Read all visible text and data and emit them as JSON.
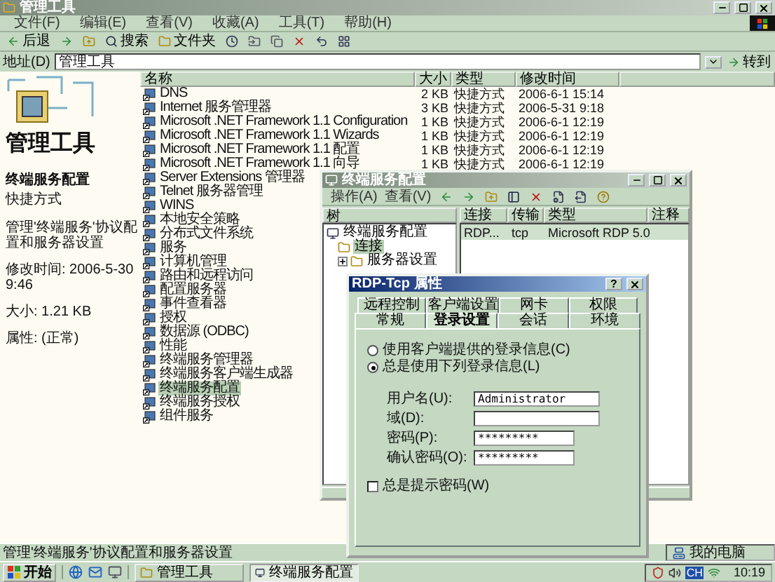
{
  "window": {
    "title": "管理工具"
  },
  "menu": [
    "文件(F)",
    "编辑(E)",
    "查看(V)",
    "收藏(A)",
    "工具(T)",
    "帮助(H)"
  ],
  "toolbar": [
    {
      "kind": "back",
      "label": "后退"
    },
    {
      "kind": "forward"
    },
    {
      "kind": "up"
    },
    {
      "kind": "search",
      "label": "搜索"
    },
    {
      "kind": "folders",
      "label": "文件夹"
    },
    {
      "kind": "history"
    },
    {
      "kind": "move"
    },
    {
      "kind": "copy"
    },
    {
      "kind": "delete"
    },
    {
      "kind": "undo"
    },
    {
      "kind": "views"
    }
  ],
  "address": {
    "label": "地址(D)",
    "value": "管理工具",
    "go": "转到"
  },
  "info_panel": {
    "heading": "管理工具",
    "item_name": "终端服务配置",
    "item_type": "快捷方式",
    "description": "管理'终端服务'协议配置和服务器设置",
    "details": [
      "修改时间: 2006-5-30 9:46",
      "大小: 1.21 KB",
      "属性: (正常)"
    ]
  },
  "file_list": {
    "columns": [
      "名称",
      "大小",
      "类型",
      "修改时间"
    ],
    "rows": [
      {
        "name": "DNS",
        "size": "2 KB",
        "type": "快捷方式",
        "modified": "2006-6-1 15:14",
        "selected": false
      },
      {
        "name": "Internet 服务管理器",
        "size": "3 KB",
        "type": "快捷方式",
        "modified": "2006-5-31 9:18",
        "selected": false
      },
      {
        "name": "Microsoft .NET Framework 1.1 Configuration",
        "size": "1 KB",
        "type": "快捷方式",
        "modified": "2006-6-1 12:19",
        "selected": false
      },
      {
        "name": "Microsoft .NET Framework 1.1 Wizards",
        "size": "1 KB",
        "type": "快捷方式",
        "modified": "2006-6-1 12:19",
        "selected": false
      },
      {
        "name": "Microsoft .NET Framework 1.1 配置",
        "size": "1 KB",
        "type": "快捷方式",
        "modified": "2006-6-1 12:19",
        "selected": false
      },
      {
        "name": "Microsoft .NET Framework 1.1 向导",
        "size": "1 KB",
        "type": "快捷方式",
        "modified": "2006-6-1 12:19",
        "selected": false
      },
      {
        "name": "Server Extensions 管理器",
        "selected": false
      },
      {
        "name": "Telnet 服务器管理",
        "selected": false
      },
      {
        "name": "WINS",
        "selected": false
      },
      {
        "name": "本地安全策略",
        "selected": false
      },
      {
        "name": "分布式文件系统",
        "selected": false
      },
      {
        "name": "服务",
        "selected": false
      },
      {
        "name": "计算机管理",
        "selected": false
      },
      {
        "name": "路由和远程访问",
        "selected": false
      },
      {
        "name": "配置服务器",
        "selected": false
      },
      {
        "name": "事件查看器",
        "selected": false
      },
      {
        "name": "授权",
        "selected": false
      },
      {
        "name": "数据源 (ODBC)",
        "selected": false
      },
      {
        "name": "性能",
        "selected": false
      },
      {
        "name": "终端服务管理器",
        "selected": false
      },
      {
        "name": "终端服务客户端生成器",
        "selected": false
      },
      {
        "name": "终端服务配置",
        "selected": true
      },
      {
        "name": "终端服务授权",
        "selected": false
      },
      {
        "name": "组件服务",
        "selected": false
      }
    ]
  },
  "mmc": {
    "title": "终端服务配置",
    "menu": [
      "操作(A)",
      "查看(V)"
    ],
    "toolbar": [
      {
        "kind": "back"
      },
      {
        "kind": "forward"
      },
      {
        "kind": "up"
      },
      {
        "kind": "tree"
      },
      {
        "kind": "delete"
      },
      {
        "kind": "properties"
      },
      {
        "kind": "export"
      },
      {
        "kind": "help"
      }
    ],
    "tree_header": "树",
    "tree": [
      {
        "label": "终端服务配置",
        "selected": false,
        "children": [
          {
            "label": "连接",
            "selected": true
          },
          {
            "label": "服务器设置",
            "selected": false,
            "expanded": false
          }
        ]
      }
    ],
    "columns": [
      "连接",
      "传输",
      "类型",
      "注释"
    ],
    "rows": [
      {
        "cells": [
          "RDP...",
          "tcp",
          "Microsoft RDP 5.0"
        ],
        "selected": true
      }
    ]
  },
  "dialog": {
    "title": "RDP-Tcp 属性",
    "help": "?",
    "tab_rows": [
      [
        {
          "label": "远程控制",
          "selected": false
        },
        {
          "label": "客户端设置",
          "selected": false
        },
        {
          "label": "网卡",
          "selected": false
        },
        {
          "label": "权限",
          "selected": false
        }
      ],
      [
        {
          "label": "常规",
          "selected": false
        },
        {
          "label": "登录设置",
          "selected": true
        },
        {
          "label": "会话",
          "selected": false
        },
        {
          "label": "环境",
          "selected": false
        }
      ]
    ],
    "options": [
      {
        "label": "使用客户端提供的登录信息(C)",
        "selected": false
      },
      {
        "label": "总是使用下列登录信息(L)",
        "selected": true
      }
    ],
    "fields": [
      {
        "label": "用户名(U):",
        "value": "Administrator",
        "kind": "text"
      },
      {
        "label": "域(D):",
        "kind": "text"
      },
      {
        "label": "密码(P):",
        "value": "*********",
        "kind": "password"
      },
      {
        "label": "确认密码(O):",
        "value": "*********",
        "kind": "password"
      }
    ],
    "prompt": {
      "label": "总是提示密码(W)",
      "checked": false
    }
  },
  "status_bar": {
    "text": "管理'终端服务'协议配置和服务器设置",
    "zone": "我的电脑"
  },
  "taskbar": {
    "start": "开始",
    "tasks": [
      {
        "label": "管理工具",
        "selected": false
      },
      {
        "label": "终端服务配置",
        "selected": true
      }
    ],
    "input": "CH",
    "clock": "10:19"
  }
}
